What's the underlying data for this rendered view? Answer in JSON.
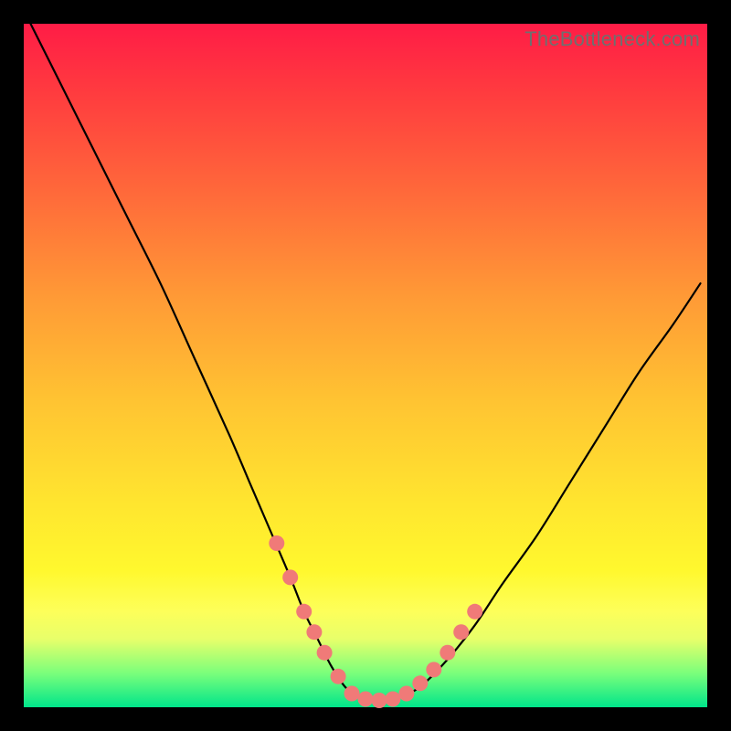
{
  "watermark": "TheBottleneck.com",
  "colors": {
    "page_bg": "#000000",
    "gradient_top": "#ff1c46",
    "gradient_bottom": "#00e58a",
    "curve_stroke": "#000000",
    "marker_fill": "#f07a78",
    "watermark_text": "#6f6f6f"
  },
  "chart_data": {
    "type": "line",
    "title": "",
    "xlabel": "",
    "ylabel": "",
    "xlim": [
      0,
      100
    ],
    "ylim": [
      0,
      100
    ],
    "grid": false,
    "legend": null,
    "note": "No axis ticks or numeric labels are rendered in the image; x and y values below are normalized 0–100 estimates read from pixel positions (origin bottom-left).",
    "series": [
      {
        "name": "curve",
        "x": [
          1,
          5,
          10,
          15,
          20,
          25,
          30,
          33,
          36,
          39,
          41,
          43,
          45,
          47,
          49,
          51,
          53,
          55,
          58,
          62,
          66,
          70,
          75,
          80,
          85,
          90,
          95,
          99
        ],
        "y": [
          100,
          92,
          82,
          72,
          62,
          51,
          40,
          33,
          26,
          19,
          14,
          10,
          6,
          3,
          1.5,
          1,
          1,
          1.5,
          3,
          7,
          12,
          18,
          25,
          33,
          41,
          49,
          56,
          62
        ]
      }
    ],
    "markers": {
      "name": "highlighted-points",
      "note": "Salmon dots clustered around the valley floor and lower walls of the curve.",
      "x": [
        37,
        39,
        41,
        42.5,
        44,
        46,
        48,
        50,
        52,
        54,
        56,
        58,
        60,
        62,
        64,
        66
      ],
      "y": [
        24,
        19,
        14,
        11,
        8,
        4.5,
        2,
        1.2,
        1,
        1.2,
        2,
        3.5,
        5.5,
        8,
        11,
        14
      ]
    }
  }
}
